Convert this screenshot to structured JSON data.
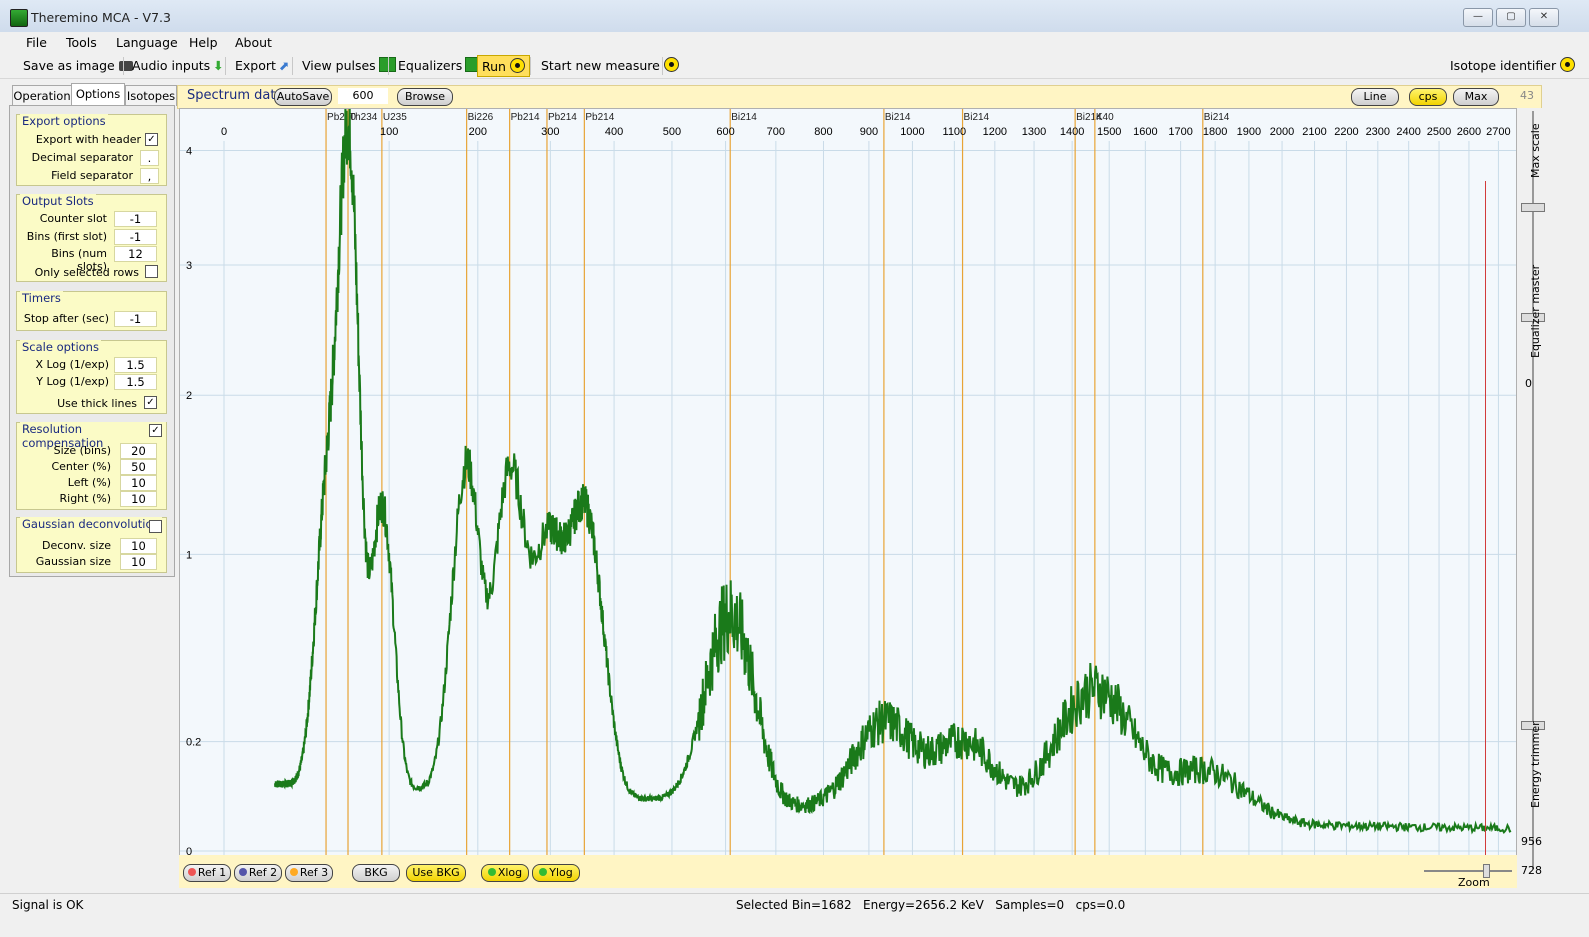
{
  "window": {
    "title": "Theremino MCA - V7.3",
    "controls": [
      "—",
      "▢",
      "✕"
    ]
  },
  "menu": [
    "File",
    "Tools",
    "Language",
    "Help",
    "About"
  ],
  "toolbar": {
    "save_as_image": "Save as image",
    "audio_inputs": "Audio inputs",
    "export": "Export",
    "view_pulses": "View pulses",
    "equalizers": "Equalizers",
    "run": "Run",
    "start_new_measure": "Start new measure",
    "isotope_identifier": "Isotope identifier"
  },
  "tabs": [
    "Operation",
    "Options",
    "Isotopes"
  ],
  "options": {
    "export": {
      "title": "Export options",
      "with_header": "Export with header",
      "with_header_checked": "✓",
      "decimal_sep": "Decimal separator",
      "decimal_sep_val": ".",
      "field_sep": "Field separator",
      "field_sep_val": ","
    },
    "slots": {
      "title": "Output Slots",
      "counter": "Counter slot",
      "counter_val": "-1",
      "bins_first": "Bins (first slot)",
      "bins_first_val": "-1",
      "bins_num": "Bins (num slots)",
      "bins_num_val": "12",
      "only_selected": "Only selected rows",
      "only_selected_checked": ""
    },
    "timers": {
      "title": "Timers",
      "stop_after": "Stop after (sec)",
      "stop_after_val": "-1"
    },
    "scale": {
      "title": "Scale options",
      "xlog": "X Log (1/exp)",
      "xlog_val": "1.5",
      "ylog": "Y Log (1/exp)",
      "ylog_val": "1.5",
      "thick": "Use thick lines",
      "thick_checked": "✓"
    },
    "resolution": {
      "title": "Resolution compensation",
      "checked": "✓",
      "size": "Size (bins)",
      "size_val": "20",
      "center": "Center (%)",
      "center_val": "50",
      "left": "Left (%)",
      "left_val": "10",
      "right": "Right (%)",
      "right_val": "10"
    },
    "gauss": {
      "title": "Gaussian deconvolution",
      "checked": "",
      "deconv": "Deconv. size",
      "deconv_val": "10",
      "gsize": "Gaussian size",
      "gsize_val": "10"
    }
  },
  "spectrum_head": {
    "title": "Spectrum data",
    "autosave": "AutoSave",
    "value": "600",
    "browse": "Browse",
    "line": "Line",
    "cps": "cps",
    "max": "Max",
    "right_val": "43"
  },
  "bottom": {
    "ref1": "Ref 1",
    "ref2": "Ref 2",
    "ref3": "Ref 3",
    "bkg": "BKG",
    "use_bkg": "Use BKG",
    "xlog": "Xlog",
    "ylog": "Ylog"
  },
  "right": {
    "max_scale": "Max scale",
    "eq_master": "Equalizer master",
    "eq_val": "0",
    "energy_trimmer": "Energy trimmer",
    "trim_val": "956",
    "zoom": "Zoom",
    "zoom_val": "728"
  },
  "status": {
    "left": "Signal is OK",
    "center": "Selected Bin=1682   Energy=2656.2 KeV   Samples=0   cps=0.0"
  },
  "colors": {
    "trace": "#1a7a1a",
    "isotope_line": "#e8a436",
    "cursor": "#d23b3b",
    "accent": "#fff36b"
  },
  "chart_data": {
    "type": "line",
    "xlabel": "",
    "ylabel": "",
    "x_ticks": [
      "0",
      "100",
      "200",
      "300",
      "400",
      "500",
      "600",
      "700",
      "800",
      "900",
      "1000",
      "1100",
      "1200",
      "1300",
      "1400",
      "1500",
      "1600",
      "1700",
      "1800",
      "1900",
      "2000",
      "2100",
      "2200",
      "2300",
      "2400",
      "2500",
      "2600",
      "2700"
    ],
    "y_ticks": [
      "0",
      "0.2",
      "1",
      "2",
      "3",
      "4"
    ],
    "isotopes": [
      {
        "label": "Pb210",
        "energy": 46
      },
      {
        "label": "Th234",
        "energy": 63
      },
      {
        "label": "U235",
        "energy": 93
      },
      {
        "label": "Bi226",
        "energy": 186
      },
      {
        "label": "Pb214",
        "energy": 242
      },
      {
        "label": "Pb214",
        "energy": 295
      },
      {
        "label": "Pb214",
        "energy": 352
      },
      {
        "label": "Bi214",
        "energy": 609
      },
      {
        "label": "Bi214",
        "energy": 934
      },
      {
        "label": "Bi214",
        "energy": 1120
      },
      {
        "label": "Bi214",
        "energy": 1408
      },
      {
        "label": "K40",
        "energy": 1461
      },
      {
        "label": "Bi214",
        "energy": 1764
      }
    ],
    "cursor_energy": 2656,
    "series": [
      {
        "name": "",
        "peaks": [
          {
            "energy": 46,
            "cps": 1.1
          },
          {
            "energy": 63,
            "cps": 4.1
          },
          {
            "energy": 93,
            "cps": 1.2
          },
          {
            "energy": 186,
            "cps": 1.45
          },
          {
            "energy": 242,
            "cps": 1.4
          },
          {
            "energy": 295,
            "cps": 0.95
          },
          {
            "energy": 352,
            "cps": 1.2
          },
          {
            "energy": 609,
            "cps": 0.65
          },
          {
            "energy": 934,
            "cps": 0.22
          },
          {
            "energy": 1120,
            "cps": 0.17
          },
          {
            "energy": 1461,
            "cps": 0.35
          },
          {
            "energy": 1764,
            "cps": 0.1
          }
        ]
      }
    ]
  }
}
